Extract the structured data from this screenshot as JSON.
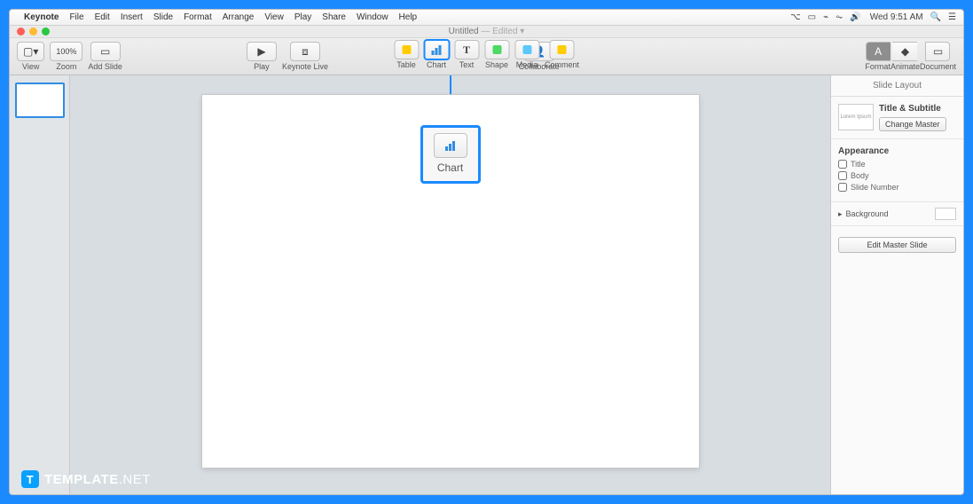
{
  "menubar": {
    "app": "Keynote",
    "items": [
      "File",
      "Edit",
      "Insert",
      "Slide",
      "Format",
      "Arrange",
      "View",
      "Play",
      "Share",
      "Window",
      "Help"
    ],
    "clock": "Wed 9:51 AM"
  },
  "titlebar": {
    "title": "Untitled",
    "status": "— Edited"
  },
  "toolbar": {
    "view": "View",
    "zoom": "Zoom",
    "zoom_value": "100%",
    "add_slide": "Add Slide",
    "play": "Play",
    "keynote_live": "Keynote Live",
    "table": "Table",
    "chart": "Chart",
    "text": "Text",
    "shape": "Shape",
    "media": "Media",
    "comment": "Comment",
    "collaborate": "Collaborate",
    "format": "Format",
    "animate": "Animate",
    "document": "Document"
  },
  "callout": {
    "label": "Chart"
  },
  "inspector": {
    "header": "Slide Layout",
    "layout_name": "Title & Subtitle",
    "change_master": "Change Master",
    "appearance": "Appearance",
    "title_cb": "Title",
    "body_cb": "Body",
    "slide_number_cb": "Slide Number",
    "background": "Background",
    "edit_master": "Edit Master Slide"
  },
  "watermark": {
    "brand": "TEMPLATE",
    "suffix": ".NET"
  }
}
